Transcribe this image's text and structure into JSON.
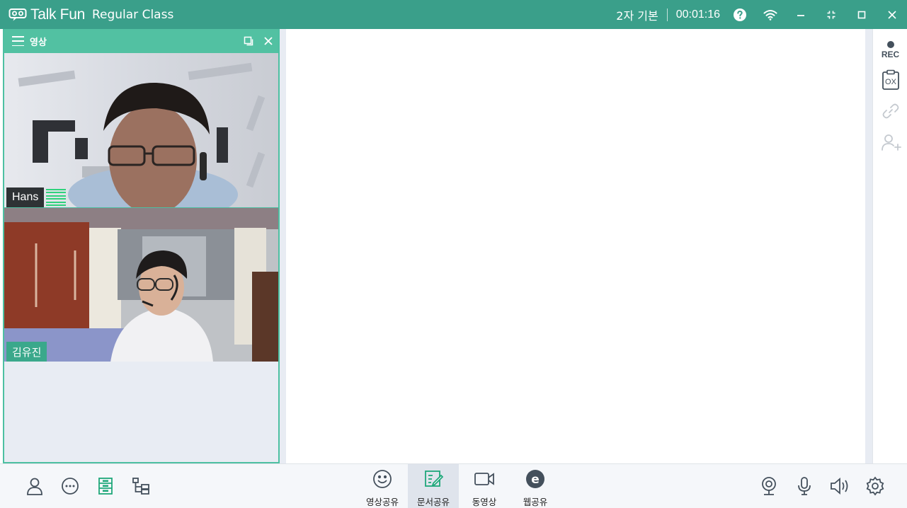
{
  "titlebar": {
    "app_name": "Talk Fun",
    "class_name": "Regular Class",
    "mode_label": "2자 기본",
    "elapsed_time": "00:01:16",
    "background_color": "#3a9f8a"
  },
  "video_panel": {
    "title": "영상",
    "accent_color": "#52c1a2",
    "participants": [
      {
        "name": "Hans",
        "audio_active": true
      },
      {
        "name": "김유진",
        "audio_active": false
      }
    ]
  },
  "right_rail": {
    "rec_label": "REC",
    "quiz_label": "OX",
    "icons": [
      "record-icon",
      "quiz-ox-icon",
      "link-icon",
      "add-user-icon"
    ]
  },
  "bottom_bar": {
    "left_icons": [
      "user-icon",
      "chat-icon",
      "whiteboard-list-icon",
      "file-tree-icon"
    ],
    "tools": [
      {
        "label": "영상공유",
        "icon": "smiley-icon",
        "active": false
      },
      {
        "label": "문서공유",
        "icon": "document-edit-icon",
        "active": true
      },
      {
        "label": "동영상",
        "icon": "video-camera-icon",
        "active": false
      },
      {
        "label": "웹공유",
        "icon": "web-e-icon",
        "active": false
      }
    ],
    "right_icons": [
      "webcam-icon",
      "microphone-icon",
      "speaker-icon",
      "settings-gear-icon"
    ]
  }
}
